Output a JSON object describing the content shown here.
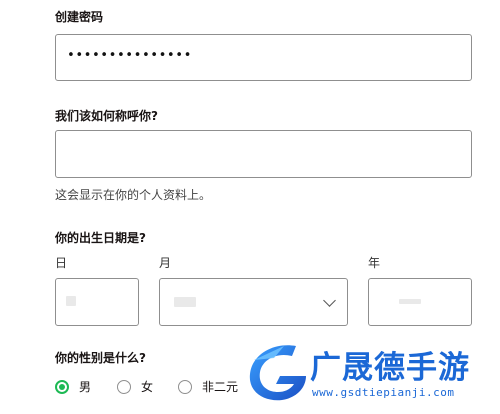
{
  "form": {
    "password": {
      "label": "创建密码",
      "value": "•••••••••••••••"
    },
    "name": {
      "label": "我们该如何称呼你?",
      "value": "",
      "hint": "这会显示在你的个人资料上。"
    },
    "birthday": {
      "label": "你的出生日期是?",
      "day_label": "日",
      "month_label": "月",
      "year_label": "年"
    },
    "gender": {
      "label": "你的性别是什么?",
      "options": [
        {
          "label": "男",
          "selected": true
        },
        {
          "label": "女",
          "selected": false
        },
        {
          "label": "非二元",
          "selected": false
        }
      ]
    }
  },
  "watermark": {
    "text": "广晟德手游",
    "url": "www.gsdtiepianji.com",
    "color": "#1b68d6",
    "logo_icon": "stylized-g-logo"
  },
  "colors": {
    "accent": "#1db954",
    "border": "#8f8f8f"
  }
}
